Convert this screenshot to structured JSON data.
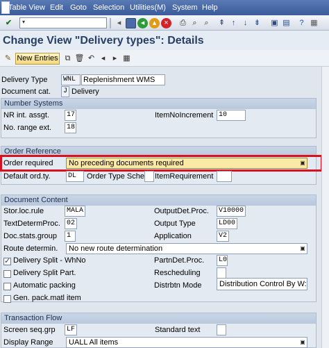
{
  "menu": {
    "items": [
      "Table View",
      "Edit",
      "Goto",
      "Selection",
      "Utilities(M)",
      "System",
      "Help"
    ]
  },
  "toolbar": {
    "icons": [
      "enter-icon",
      "save-icon",
      "back-icon",
      "exit-icon",
      "cancel-icon",
      "print-icon",
      "find-icon",
      "find-next-icon",
      "first-page-icon",
      "prev-page-icon",
      "next-page-icon",
      "last-page-icon",
      "create-session-icon",
      "shortcut-icon"
    ]
  },
  "title": "Change View \"Delivery types\": Details",
  "app_toolbar": {
    "new_entries_label": "New Entries"
  },
  "header": {
    "delivery_type_label": "Delivery Type",
    "delivery_type_value": "WNL",
    "delivery_type_desc": "Replenishment WMS",
    "document_cat_label": "Document cat.",
    "document_cat_value": "J",
    "document_cat_desc": "Delivery"
  },
  "number_systems": {
    "title": "Number Systems",
    "nr_int_label": "NR int. assgt.",
    "nr_int_value": "17",
    "no_range_ext_label": "No. range ext.",
    "no_range_ext_value": "18",
    "item_no_inc_label": "ItemNoIncrement",
    "item_no_inc_value": "10"
  },
  "order_reference": {
    "title": "Order Reference",
    "order_required_label": "Order required",
    "order_required_value": "No preceding documents required",
    "default_ord_label": "Default ord.ty.",
    "default_ord_value": "DL",
    "order_type_sched_label": "Order Type Sched",
    "item_requirement_label": "ItemRequirement"
  },
  "document_content": {
    "title": "Document Content",
    "stor_loc_rule_label": "Stor.loc.rule",
    "stor_loc_rule_value": "MALA",
    "text_determ_label": "TextDetermProc.",
    "text_determ_value": "02",
    "doc_stats_label": "Doc.stats.group",
    "doc_stats_value": "1",
    "route_determ_label": "Route determin.",
    "route_determ_value": "No new route determination",
    "delivery_split_whno_label": "Delivery Split - WhNo",
    "delivery_split_whno_checked": true,
    "delivery_split_part_label": "Delivery Split Part.",
    "automatic_packing_label": "Automatic packing",
    "gen_pack_matl_label": "Gen. pack.matl item",
    "output_det_label": "OutputDet.Proc.",
    "output_det_value": "V10000",
    "output_type_label": "Output Type",
    "output_type_value": "LD00",
    "application_label": "Application",
    "application_value": "V2",
    "partn_det_label": "PartnDet.Proc.",
    "partn_det_value": "L0",
    "rescheduling_label": "Rescheduling",
    "distrbtn_mode_label": "Distrbtn Mode",
    "distrbtn_mode_value": "Distribution Control By W:"
  },
  "transaction_flow": {
    "title": "Transaction Flow",
    "screen_seq_label": "Screen seq.grp",
    "screen_seq_value": "LF",
    "standard_text_label": "Standard text",
    "display_range_label": "Display Range",
    "display_range_value": "UALL All items"
  },
  "colors": {
    "menubar": "#3a5b9a",
    "title_text": "#273e65",
    "highlight_border": "#d81020",
    "new_entries_button": "#f2d77c"
  }
}
